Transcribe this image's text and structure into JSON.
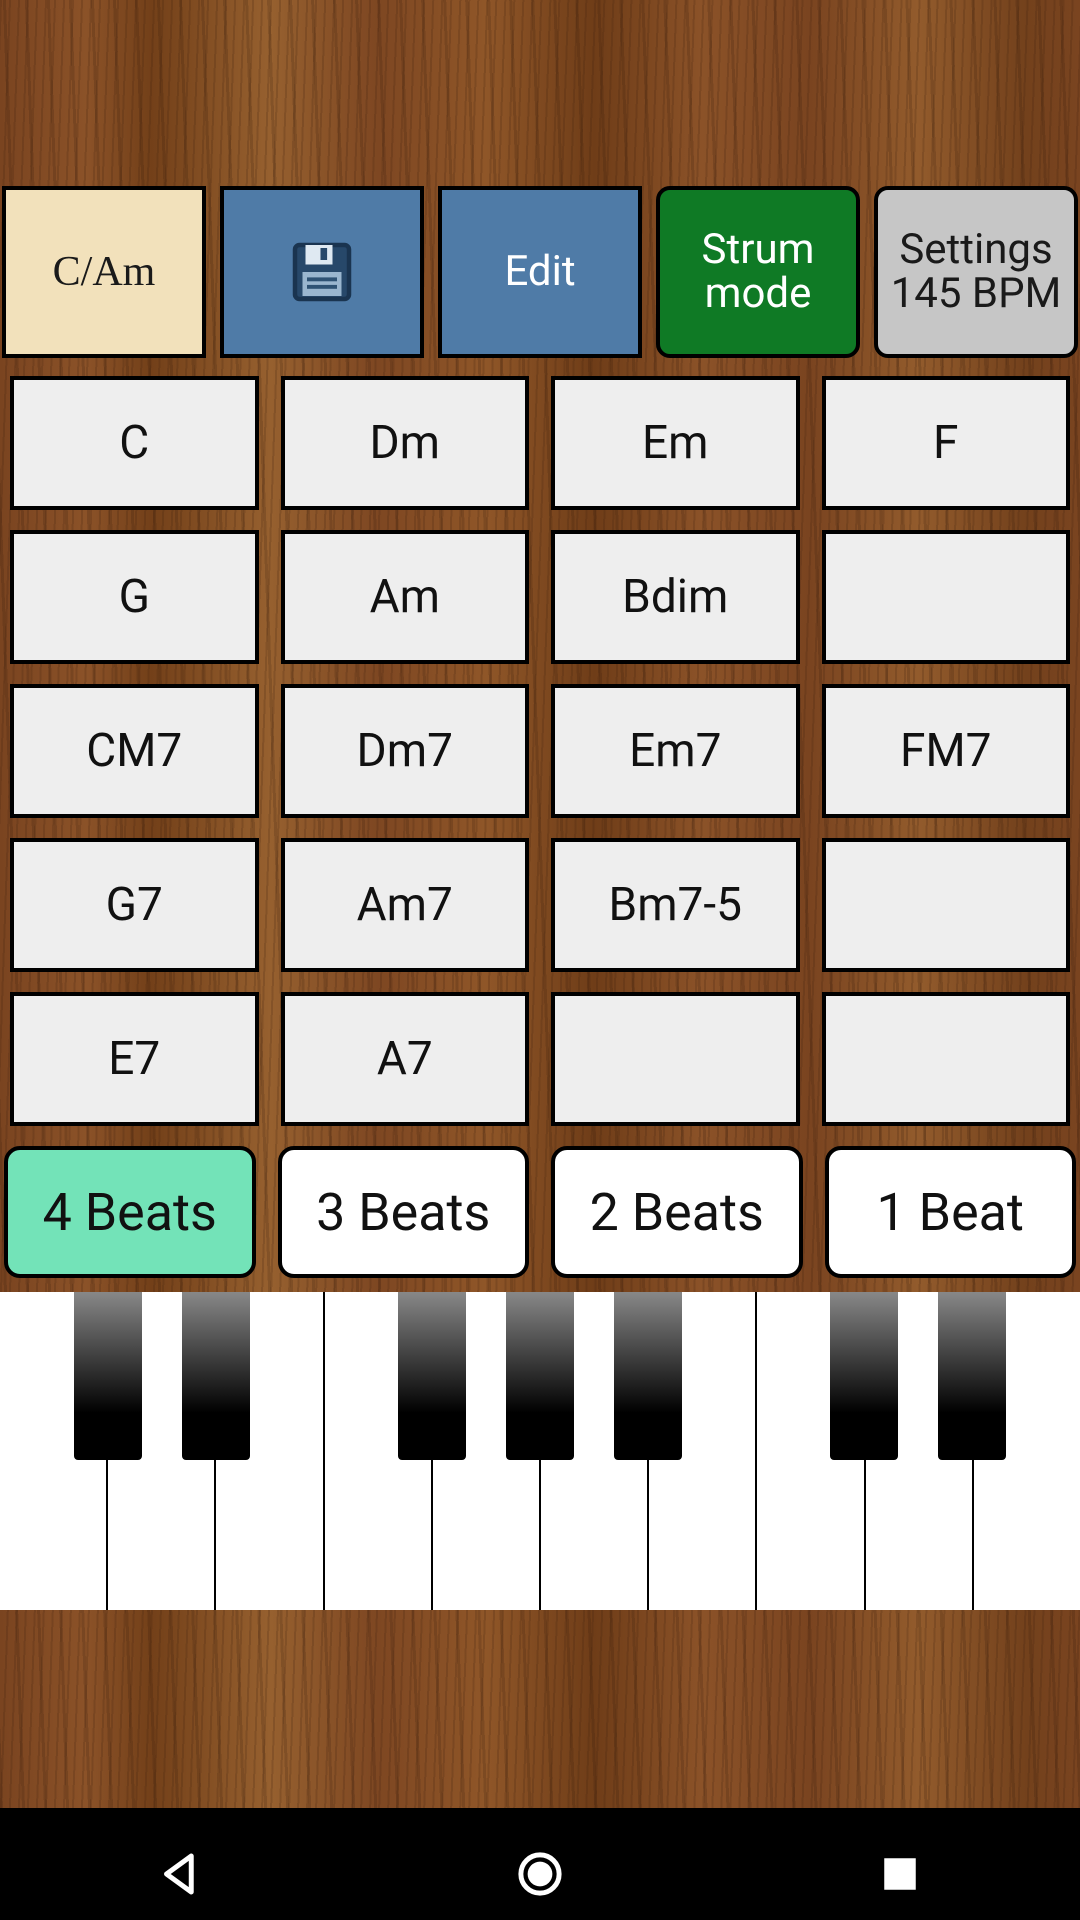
{
  "toolbar": {
    "key_label": "C/Am",
    "save_icon": "save-icon",
    "edit_label": "Edit",
    "strum_line1": "Strum",
    "strum_line2": "mode",
    "settings_line1": "Settings",
    "settings_line2": "145 BPM"
  },
  "chords": [
    [
      "C",
      "Dm",
      "Em",
      "F"
    ],
    [
      "G",
      "Am",
      "Bdim",
      ""
    ],
    [
      "CM7",
      "Dm7",
      "Em7",
      "FM7"
    ],
    [
      "G7",
      "Am7",
      "Bm7-5",
      ""
    ],
    [
      "E7",
      "A7",
      "",
      ""
    ]
  ],
  "beats": {
    "items": [
      "4 Beats",
      "3 Beats",
      "2 Beats",
      "1 Beat"
    ],
    "active_index": 0
  },
  "piano": {
    "white_key_count": 10,
    "black_key_positions": [
      1,
      2,
      4,
      5,
      6,
      8,
      9
    ]
  },
  "colors": {
    "blue": "#4f7ba7",
    "green": "#0f7a25",
    "grey": "#c6c6c6",
    "cream": "#f2e1bb",
    "mint": "#73e3b8",
    "cell": "#eeeeee"
  }
}
